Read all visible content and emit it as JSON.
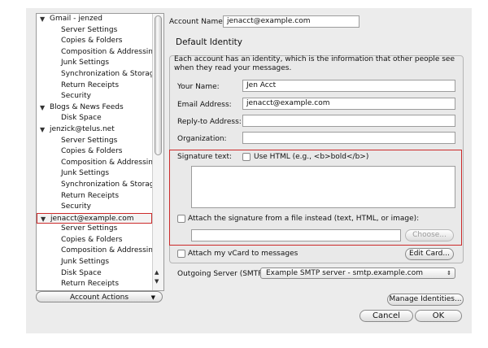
{
  "tree": {
    "items": [
      {
        "label": "Gmail - jenzed",
        "level": "account",
        "expanded": true
      },
      {
        "label": "Server Settings",
        "level": "sub"
      },
      {
        "label": "Copies & Folders",
        "level": "sub"
      },
      {
        "label": "Composition & Addressing",
        "level": "sub"
      },
      {
        "label": "Junk Settings",
        "level": "sub"
      },
      {
        "label": "Synchronization & Storage",
        "level": "sub"
      },
      {
        "label": "Return Receipts",
        "level": "sub"
      },
      {
        "label": "Security",
        "level": "sub"
      },
      {
        "label": "Blogs & News Feeds",
        "level": "account",
        "expanded": true
      },
      {
        "label": "Disk Space",
        "level": "sub"
      },
      {
        "label": "jenzick@telus.net",
        "level": "account",
        "expanded": true
      },
      {
        "label": "Server Settings",
        "level": "sub"
      },
      {
        "label": "Copies & Folders",
        "level": "sub"
      },
      {
        "label": "Composition & Addressing",
        "level": "sub"
      },
      {
        "label": "Junk Settings",
        "level": "sub"
      },
      {
        "label": "Synchronization & Storage",
        "level": "sub"
      },
      {
        "label": "Return Receipts",
        "level": "sub"
      },
      {
        "label": "Security",
        "level": "sub"
      },
      {
        "label": "jenacct@example.com",
        "level": "account",
        "expanded": true,
        "selected": true
      },
      {
        "label": "Server Settings",
        "level": "sub"
      },
      {
        "label": "Copies & Folders",
        "level": "sub"
      },
      {
        "label": "Composition & Addressing",
        "level": "sub"
      },
      {
        "label": "Junk Settings",
        "level": "sub"
      },
      {
        "label": "Disk Space",
        "level": "sub"
      },
      {
        "label": "Return Receipts",
        "level": "sub"
      }
    ],
    "account_actions_label": "Account Actions"
  },
  "account": {
    "name_label": "Account Name:",
    "name_value": "jenacct@example.com"
  },
  "identity": {
    "title": "Default Identity",
    "description": "Each account has an identity, which is the information that other people see when they read your messages.",
    "your_name_label": "Your Name:",
    "your_name_value": "Jen Acct",
    "email_label": "Email Address:",
    "email_value": "jenacct@example.com",
    "reply_to_label": "Reply-to Address:",
    "reply_to_value": "",
    "organization_label": "Organization:",
    "organization_value": ""
  },
  "signature": {
    "label": "Signature text:",
    "use_html_label": "Use HTML (e.g., <b>bold</b>)",
    "attach_file_label": "Attach the signature from a file instead (text, HTML, or image):",
    "choose_label": "Choose..."
  },
  "vcard": {
    "attach_label": "Attach my vCard to messages",
    "edit_label": "Edit Card..."
  },
  "smtp": {
    "label": "Outgoing Server (SMTP):",
    "value": "Example SMTP server - smtp.example.com"
  },
  "buttons": {
    "manage_identities": "Manage Identities...",
    "cancel": "Cancel",
    "ok": "OK"
  }
}
